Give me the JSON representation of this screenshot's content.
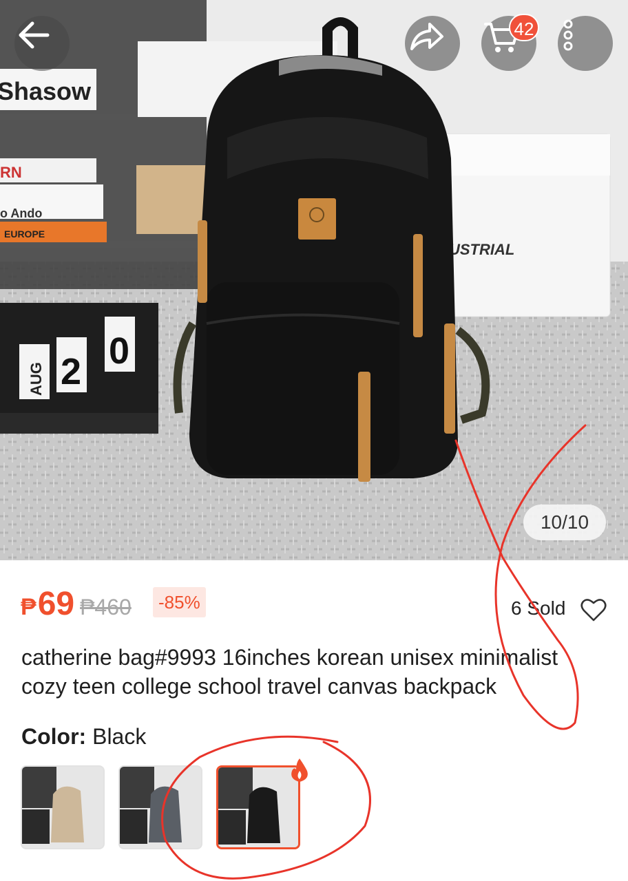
{
  "header": {
    "back_icon": "arrow-left-icon",
    "share_icon": "share-arrow-icon",
    "cart_icon": "cart-icon",
    "cart_count": "42",
    "more_icon": "more-vertical-icon"
  },
  "gallery": {
    "counter": "10/10",
    "scene_text": {
      "book_spine": "Shasow",
      "book2": "RN",
      "book3": "o Ando",
      "book4": "EUROPE",
      "box_label": "USTRIAL",
      "calendar_month": "AUG",
      "calendar_d1": "2",
      "calendar_d2": "0"
    }
  },
  "product": {
    "currency": "₱",
    "price": "69",
    "original_price": "₱460",
    "discount": "-85%",
    "sold": "6 Sold",
    "title": "catherine bag#9993 16inches korean unisex minimalist cozy teen college school travel canvas backpack",
    "color_label": "Color:",
    "color_value": "Black"
  },
  "variants": [
    {
      "name": "Khaki",
      "color": "#cdb89a"
    },
    {
      "name": "Grey",
      "color": "#5a5f66"
    },
    {
      "name": "Black",
      "color": "#1a1a1a",
      "selected": true
    }
  ],
  "colors": {
    "accent": "#f0502d",
    "annotation": "#e8342a"
  }
}
